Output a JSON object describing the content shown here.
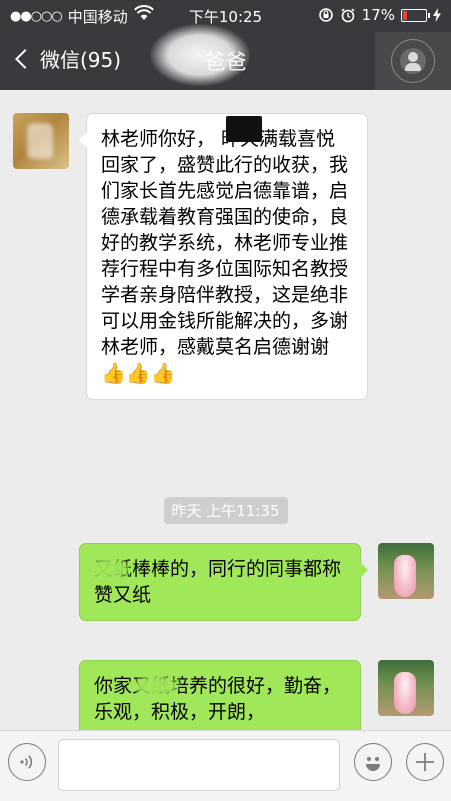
{
  "status_bar": {
    "signal": "●●○○○",
    "carrier": "中国移动",
    "time": "下午10:25",
    "battery": "17%",
    "battery_level": 0.17
  },
  "nav": {
    "back_label": "微信(95)",
    "title": "爸爸"
  },
  "messages": [
    {
      "side": "left",
      "text": "林老师你好，  昨天满载喜悦回家了，盛赞此行的收获，我们家长首先感觉启德靠谱，启德承载着教育强国的使命，良好的教学系统，林老师专业推荐行程中有多位国际知名教授学者亲身陪伴教授，这是绝非可以用金钱所能解决的，多谢林老师，感戴莫名启德谢谢",
      "emoji": "👍👍👍"
    },
    {
      "side": "right",
      "text": "又纸棒棒的，同行的同事都称赞又纸"
    },
    {
      "side": "right",
      "text": "你家又纸培养的很好，勤奋，乐观，积极，开朗，"
    }
  ],
  "timestamp": "昨天 上午11:35",
  "colors": {
    "header": "#393a3e",
    "background": "#ececec",
    "sent_bubble": "#a0e75a",
    "received_bubble": "#ffffff",
    "battery_low": "#ff3b30"
  },
  "icons": [
    "wifi-icon",
    "rotation-lock-icon",
    "alarm-icon",
    "battery-icon",
    "charging-icon",
    "chevron-left-icon",
    "profile-icon",
    "voice-icon",
    "emoji-icon",
    "plus-icon"
  ]
}
